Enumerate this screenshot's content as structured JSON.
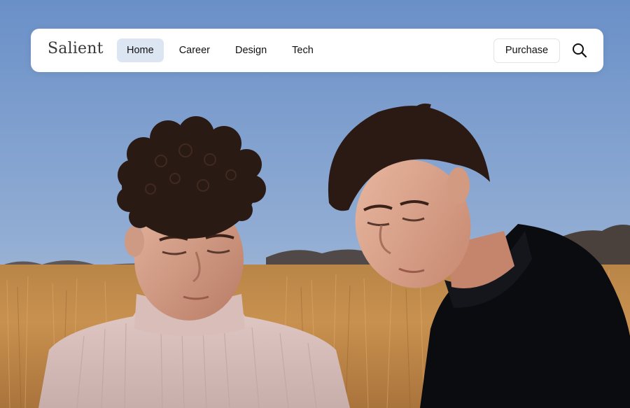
{
  "brand": {
    "name": "Salient"
  },
  "nav": {
    "items": [
      {
        "label": "Home",
        "active": true
      },
      {
        "label": "Career",
        "active": false
      },
      {
        "label": "Design",
        "active": false
      },
      {
        "label": "Tech",
        "active": false
      }
    ],
    "purchase_label": "Purchase",
    "search_icon": "search-icon"
  },
  "hero": {
    "image_subject": "two-young-men-in-wheat-field",
    "colors": {
      "sky_top": "#6a90c8",
      "sky_bottom": "#b7c6da",
      "field": "#c8914f",
      "left_sweater": "#d9c2bf",
      "right_sweater": "#0b0c10",
      "hair": "#2a1a14",
      "skin": "#d9a48e"
    }
  },
  "theme": {
    "accent": "#dce6f3",
    "navbar_bg": "#ffffff"
  }
}
